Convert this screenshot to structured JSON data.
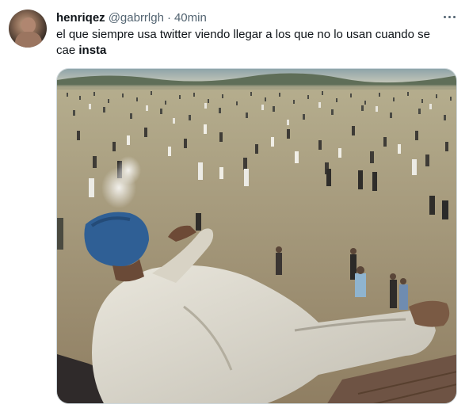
{
  "tweet": {
    "author": {
      "display_name": "henriqez",
      "handle": "@gabrrlgh",
      "avatar_icon": "profile-avatar"
    },
    "separator": "·",
    "timestamp": "40min",
    "more_icon": "more-options-icon",
    "text_prefix": "el que siempre usa twitter viendo llegar a los que no lo usan cuando se cae ",
    "text_bold": "insta",
    "media": {
      "kind": "photo",
      "icon": "attached-photo"
    }
  },
  "colors": {
    "text_primary": "#0f1419",
    "text_secondary": "#536471",
    "border": "#cfd9de",
    "background": "#ffffff"
  }
}
